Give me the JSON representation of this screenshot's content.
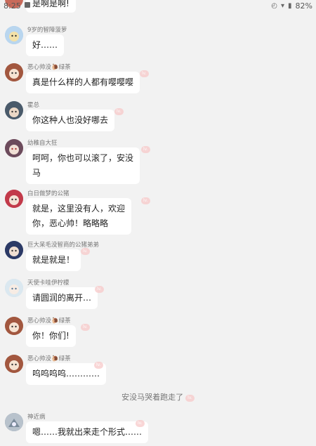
{
  "status_bar": {
    "time": "8:25",
    "battery": "82%",
    "icons": [
      "notification-icon",
      "alarm-icon",
      "wifi-icon",
      "battery-icon"
    ]
  },
  "messages": [
    {
      "name": "",
      "text": "是啊是啊!",
      "avatar_color": "#c86a5a"
    },
    {
      "name": "9岁的智障菠萝",
      "text": "好……",
      "avatar_color": "#a8c8e8"
    },
    {
      "name": "恶心帅没🐌绿茶",
      "text": "真是什么样的人都有嘤嘤嘤",
      "avatar_color": "#b8785c"
    },
    {
      "name": "霍总",
      "text": "你这种人也没好哪去",
      "avatar_color": "#6a7d8c"
    },
    {
      "name": "幼稚自大狂",
      "text_lines": [
        "呵呵，你也可以滚了，安没",
        "马"
      ],
      "avatar_color": "#9a6b7a"
    },
    {
      "name": "白日做梦的公猪",
      "text_lines": [
        "就是，这里没有人，欢迎",
        "你，恶心帅！略略略"
      ],
      "avatar_color": "#c8485a"
    },
    {
      "name": "巨大呆毛没智商的公猪弟弟",
      "text": "就是就是！",
      "avatar_color": "#3a4a7a"
    },
    {
      "name": "天使卡哇伊柠檬",
      "text": "请圆润的离开…",
      "avatar_color": "#c8dce8"
    },
    {
      "name": "恶心帅没🐌绿茶",
      "text": "你！你们!",
      "avatar_color": "#b8785c"
    },
    {
      "name": "恶心帅没🐌绿茶",
      "text": "呜呜呜呜…………",
      "avatar_color": "#b8785c"
    },
    {
      "name": "神近病",
      "text": "嗯……我就出来走个形式……",
      "avatar_color": "#8a98a8"
    }
  ],
  "system_message": "安没马哭着跑走了",
  "level_badge": "lv."
}
